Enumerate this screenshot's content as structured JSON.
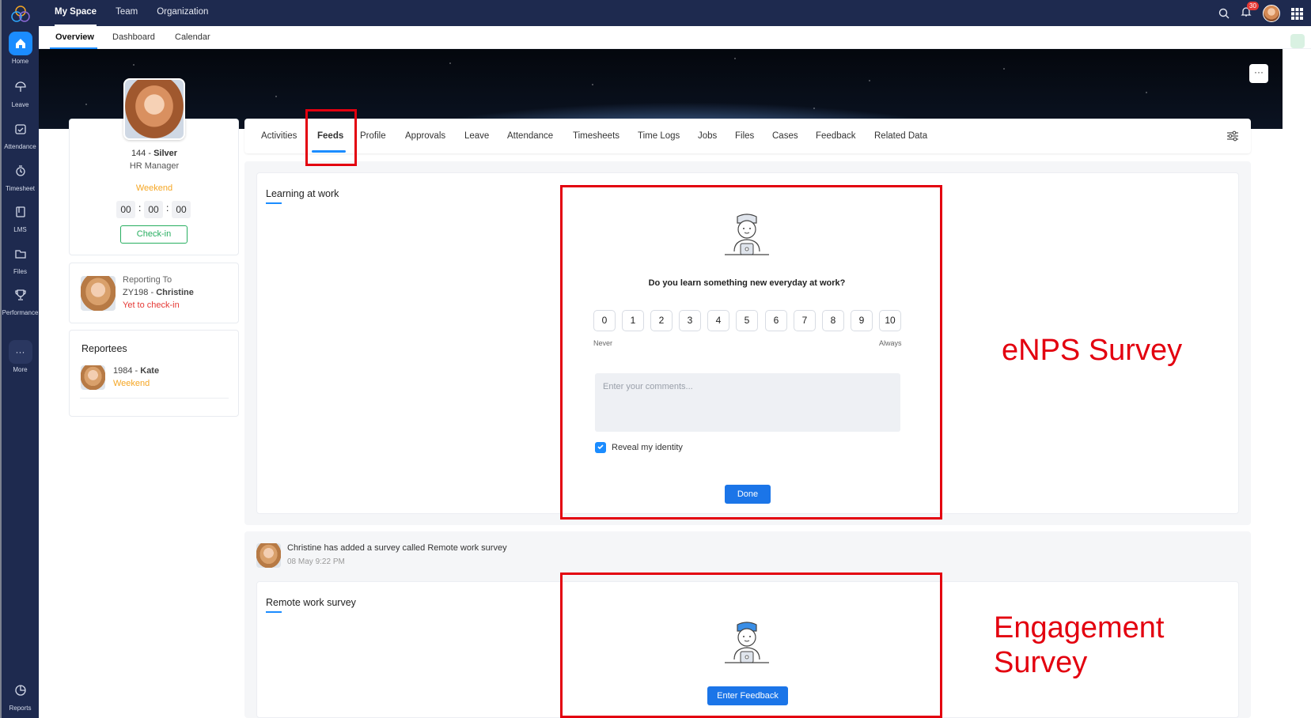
{
  "top_nav": {
    "items": [
      "My Space",
      "Team",
      "Organization"
    ],
    "notification_count": "30"
  },
  "sub_nav": {
    "items": [
      "Overview",
      "Dashboard",
      "Calendar"
    ]
  },
  "sidebar": {
    "items": [
      "Home",
      "Leave",
      "Attendance",
      "Timesheet",
      "LMS",
      "Files",
      "Performance",
      "More"
    ],
    "bottom": "Reports"
  },
  "banner": {
    "more_label": "···"
  },
  "profile": {
    "id": "144 - ",
    "name": "Silver",
    "role": "HR Manager",
    "status": "Weekend",
    "timer": [
      "00",
      "00",
      "00"
    ],
    "checkin": "Check-in"
  },
  "reporting": {
    "label": "Reporting To",
    "id": "ZY198 - ",
    "name": "Christine",
    "status": "Yet to check-in"
  },
  "reportees": {
    "title": "Reportees",
    "id": "1984 - ",
    "name": "Kate",
    "status": "Weekend"
  },
  "tabs": [
    "Activities",
    "Feeds",
    "Profile",
    "Approvals",
    "Leave",
    "Attendance",
    "Timesheets",
    "Time Logs",
    "Jobs",
    "Files",
    "Cases",
    "Feedback",
    "Related Data"
  ],
  "survey1": {
    "title": "Learning at work",
    "question": "Do you learn something new everyday at work?",
    "scale": [
      "0",
      "1",
      "2",
      "3",
      "4",
      "5",
      "6",
      "7",
      "8",
      "9",
      "10"
    ],
    "min_label": "Never",
    "max_label": "Always",
    "comments_placeholder": "Enter your comments...",
    "reveal_label": "Reveal my identity",
    "done": "Done"
  },
  "post": {
    "text": "Christine has added a survey called Remote work survey",
    "time": "08 May 9:22 PM"
  },
  "survey2": {
    "title": "Remote work survey",
    "button": "Enter Feedback"
  },
  "annotations": {
    "enps": "eNPS Survey",
    "engagement_line1": "Engagement",
    "engagement_line2": "Survey"
  },
  "colors": {
    "sidebar": "#1e2a4f",
    "accent": "#1b8cff",
    "annotation": "#e3000f",
    "weekend": "#f5a623",
    "alert": "#e53935",
    "checkin": "#27ae60"
  }
}
